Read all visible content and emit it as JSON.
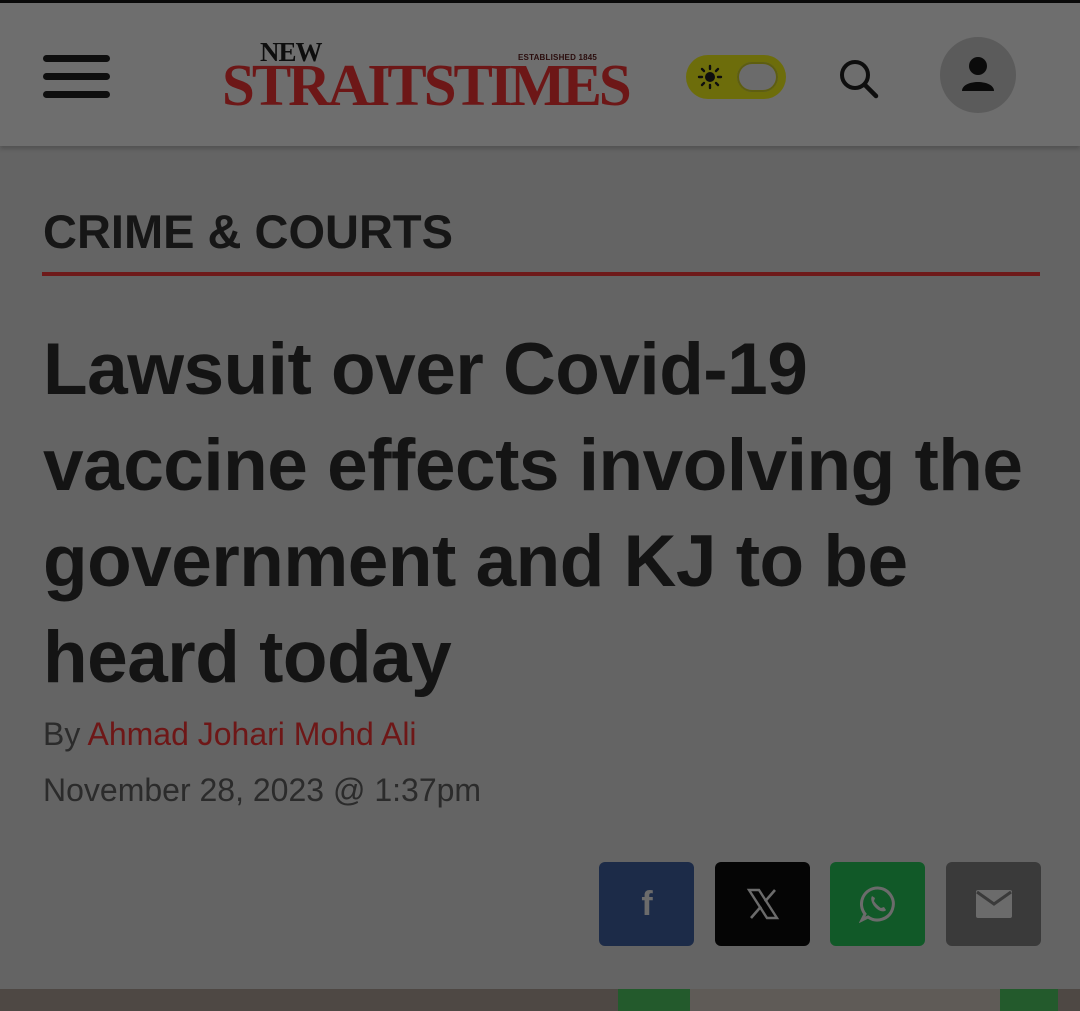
{
  "header": {
    "menu_icon": "hamburger-menu-icon",
    "logo": {
      "top_word": "NEW",
      "established": "ESTABLISHED 1845",
      "name": "STRAITSTIMES"
    },
    "theme_toggle_icon": "sun-icon",
    "search_icon": "search-icon",
    "profile_icon": "user-icon"
  },
  "article": {
    "section": "CRIME & COURTS",
    "headline": "Lawsuit over Covid-19 vaccine effects involving the government and KJ to be heard today",
    "byline_prefix": "By",
    "author": "Ahmad Johari Mohd Ali",
    "date": "November 28, 2023 @ 1:37pm"
  },
  "share": {
    "facebook_label": "f",
    "x_icon": "x-logo-icon",
    "whatsapp_icon": "whatsapp-icon",
    "email_icon": "mail-icon"
  },
  "colors": {
    "brand_red": "#6e1717",
    "facebook": "#1c2b48",
    "x": "#050505",
    "whatsapp": "#115928",
    "email": "#3a3a3a",
    "overlay_background": "#646464"
  }
}
